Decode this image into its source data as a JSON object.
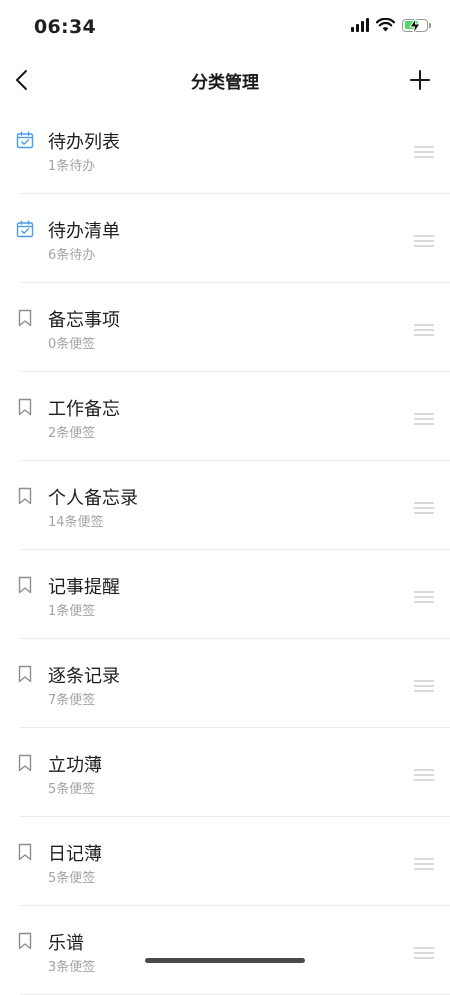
{
  "status_bar": {
    "time": "06:34",
    "icons": [
      "signal-icon",
      "wifi-icon",
      "battery-charging-icon"
    ],
    "battery_color": "#4cd964"
  },
  "nav": {
    "title": "分类管理",
    "back_icon": "chevron-left-icon",
    "add_icon": "plus-icon"
  },
  "colors": {
    "todo_icon": "#4a9ee8",
    "note_icon": "#8e8e8e",
    "secondary_text": "#a3a3a3",
    "divider": "#ececec"
  },
  "categories": [
    {
      "name": "待办列表",
      "count": "1条待办",
      "icon": "calendar-check-icon"
    },
    {
      "name": "待办清单",
      "count": "6条待办",
      "icon": "calendar-check-icon"
    },
    {
      "name": "备忘事项",
      "count": "0条便签",
      "icon": "bookmark-icon"
    },
    {
      "name": "工作备忘",
      "count": "2条便签",
      "icon": "bookmark-icon"
    },
    {
      "name": "个人备忘录",
      "count": "14条便签",
      "icon": "bookmark-icon"
    },
    {
      "name": "记事提醒",
      "count": "1条便签",
      "icon": "bookmark-icon"
    },
    {
      "name": "逐条记录",
      "count": "7条便签",
      "icon": "bookmark-icon"
    },
    {
      "name": "立功薄",
      "count": "5条便签",
      "icon": "bookmark-icon"
    },
    {
      "name": "日记薄",
      "count": "5条便签",
      "icon": "bookmark-icon"
    },
    {
      "name": "乐谱",
      "count": "3条便签",
      "icon": "bookmark-icon"
    }
  ]
}
